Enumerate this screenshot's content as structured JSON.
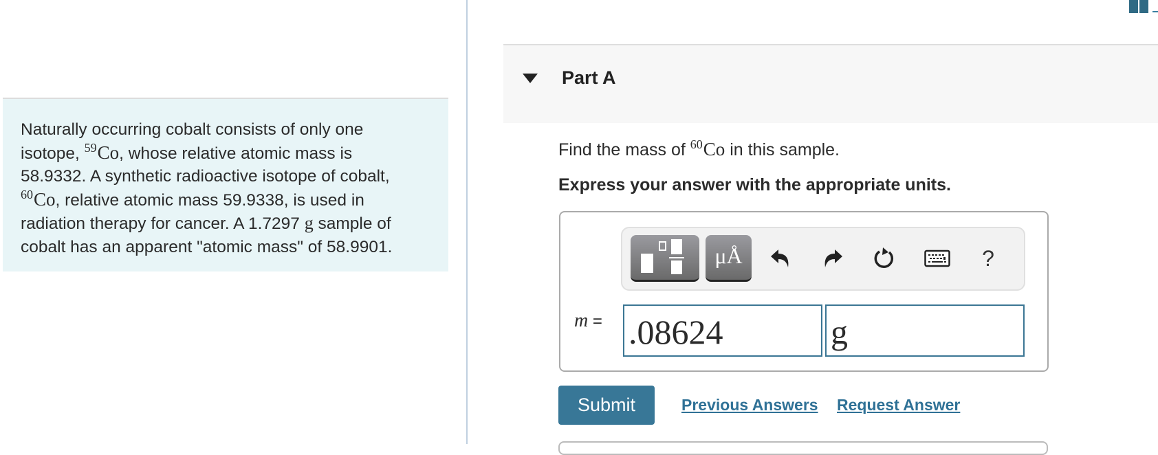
{
  "problem": {
    "line1": "Naturally occurring cobalt consists of only one",
    "line2_pre": "isotope, ",
    "iso59_mass": "59",
    "element": "Co",
    "line2_post": ", whose relative atomic mass is",
    "line3": "58.9332. A synthetic radioactive isotope of cobalt,",
    "iso60_mass": "60",
    "line4_post": ", relative atomic mass 59.9338, is used in",
    "line5_pre": "radiation therapy for cancer. A 1.7297 ",
    "line5_unit": "g",
    "line5_post": " sample of",
    "line6": "cobalt has an apparent \"atomic mass\" of 58.9901."
  },
  "part": {
    "title": "Part A",
    "question_pre": "Find the mass of ",
    "question_mass": "60",
    "question_element": "Co",
    "question_post": " in this sample.",
    "instruction": "Express your answer with the appropriate units."
  },
  "toolbar": {
    "templates_icon": "templates-icon",
    "units_label": "μÅ",
    "undo_icon": "undo-icon",
    "redo_icon": "redo-icon",
    "reset_icon": "reset-icon",
    "keyboard_icon": "keyboard-icon",
    "help_label": "?"
  },
  "answer": {
    "variable": "m",
    "equals": "=",
    "value": ".08624",
    "unit": "g"
  },
  "actions": {
    "submit_label": "Submit",
    "previous_answers_label": "Previous Answers",
    "request_answer_label": "Request Answer"
  },
  "colors": {
    "accent": "#387797",
    "link": "#2f7196",
    "problem_bg": "#e8f5f7",
    "input_border": "#3b7694"
  }
}
